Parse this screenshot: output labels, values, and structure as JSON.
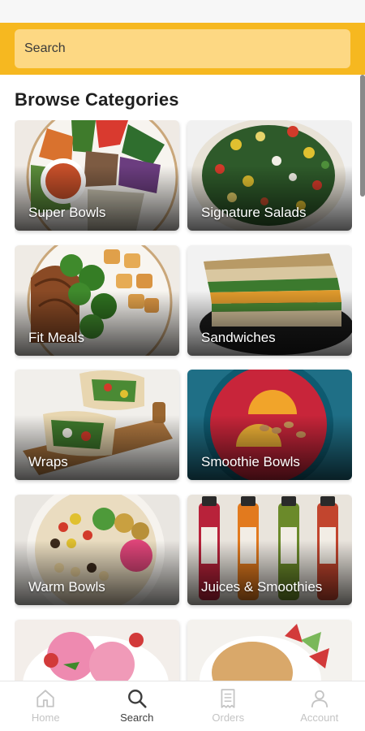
{
  "search": {
    "placeholder": "Search"
  },
  "section_title": "Browse Categories",
  "categories": [
    {
      "label": "Super Bowls"
    },
    {
      "label": "Signature Salads"
    },
    {
      "label": "Fit Meals"
    },
    {
      "label": "Sandwiches"
    },
    {
      "label": "Wraps"
    },
    {
      "label": "Smoothie Bowls"
    },
    {
      "label": "Warm Bowls"
    },
    {
      "label": "Juices & Smoothies"
    },
    {
      "label": ""
    },
    {
      "label": ""
    }
  ],
  "nav": {
    "items": [
      {
        "label": "Home",
        "icon": "home-icon",
        "active": false
      },
      {
        "label": "Search",
        "icon": "search-icon",
        "active": true
      },
      {
        "label": "Orders",
        "icon": "receipt-icon",
        "active": false
      },
      {
        "label": "Account",
        "icon": "person-icon",
        "active": false
      }
    ]
  },
  "colors": {
    "accent": "#f6b820",
    "search_field": "#fdd883",
    "nav_active": "#3d3d3d",
    "nav_inactive": "#c4c4c4"
  }
}
